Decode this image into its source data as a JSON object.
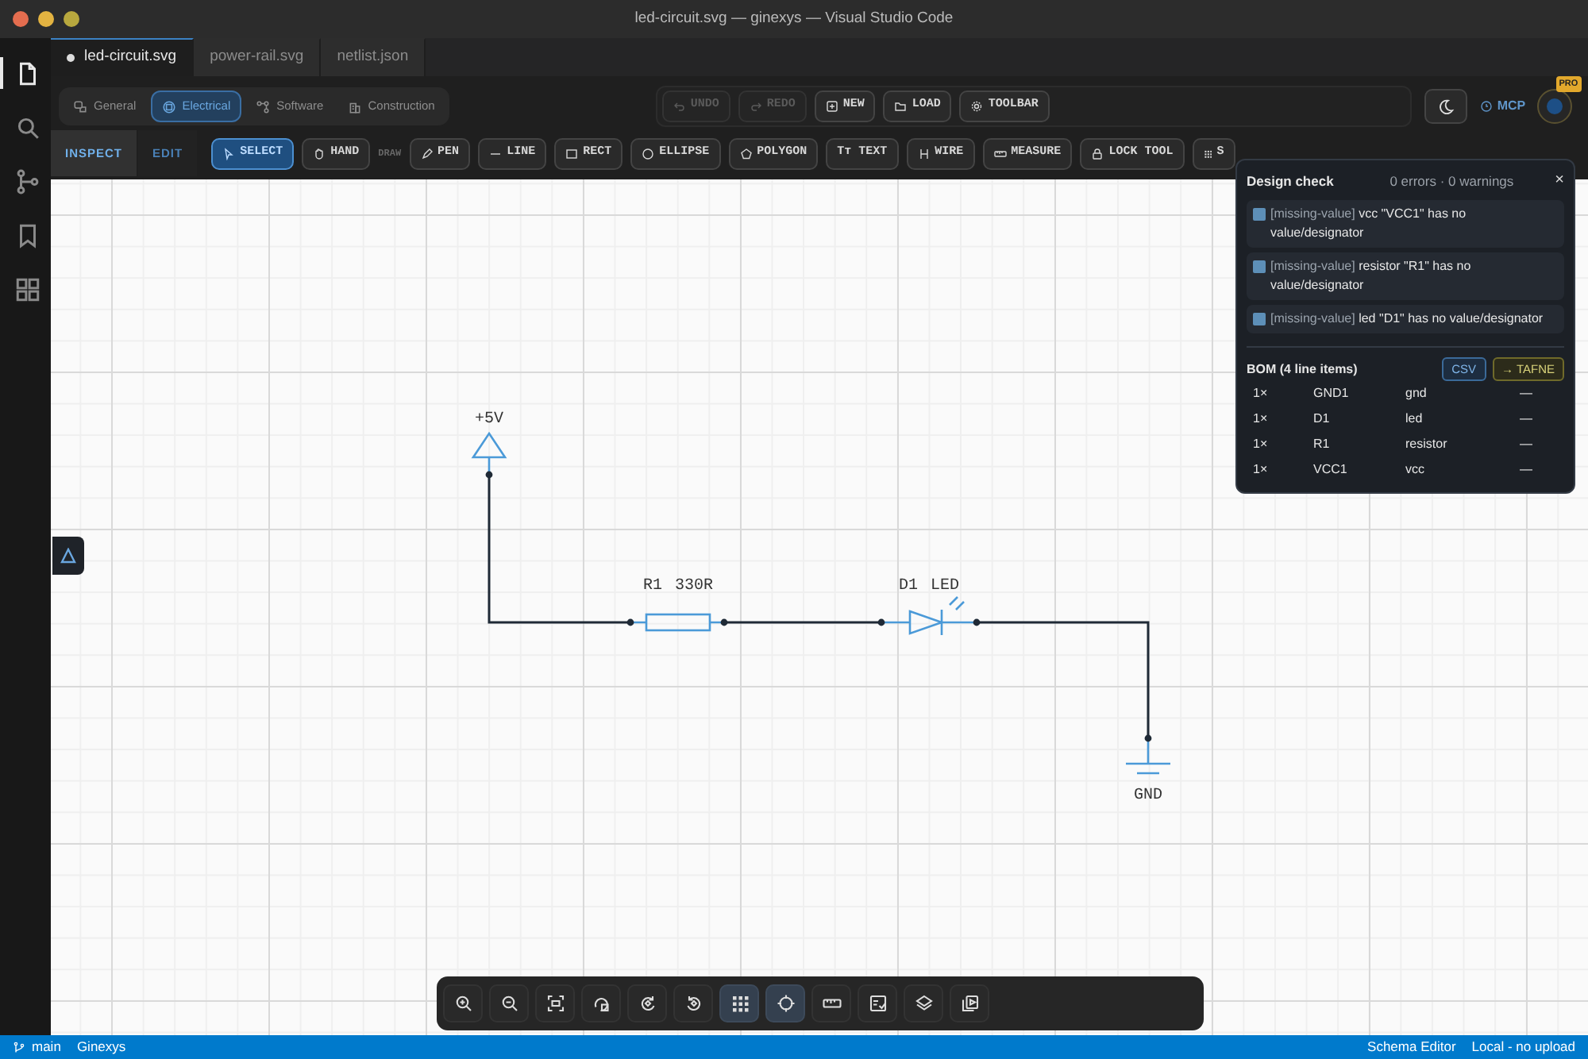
{
  "window": {
    "title": "led-circuit.svg — ginexys — Visual Studio Code"
  },
  "activity_bar": [
    {
      "kind": "files",
      "selected": true
    },
    {
      "kind": "search",
      "selected": false
    },
    {
      "kind": "scm",
      "selected": false
    },
    {
      "kind": "bookmark",
      "selected": false
    },
    {
      "kind": "extensions",
      "selected": false
    }
  ],
  "tabs": [
    {
      "label": "led-circuit.svg",
      "selected": true,
      "modified": true
    },
    {
      "label": "power-rail.svg",
      "selected": false,
      "modified": false
    },
    {
      "label": "netlist.json",
      "selected": false,
      "modified": false
    }
  ],
  "categories": [
    {
      "kind": "general",
      "label": "General",
      "selected": false
    },
    {
      "kind": "electrical",
      "label": "Electrical",
      "selected": true
    },
    {
      "kind": "software",
      "label": "Software",
      "selected": false
    },
    {
      "kind": "construction",
      "label": "Construction",
      "selected": false
    }
  ],
  "actions": [
    {
      "kind": "undo",
      "label": "UNDO",
      "disabled": true
    },
    {
      "kind": "redo",
      "label": "REDO",
      "disabled": true
    },
    {
      "kind": "new",
      "label": "NEW",
      "disabled": false
    },
    {
      "kind": "load",
      "label": "LOAD",
      "disabled": false
    },
    {
      "kind": "toolbar",
      "label": "TOOLBAR",
      "disabled": false
    }
  ],
  "mcp": {
    "label": "MCP"
  },
  "account": {
    "badge": "PRO"
  },
  "modes": [
    {
      "label": "INSPECT",
      "selected": true
    },
    {
      "label": "EDIT",
      "selected": false
    }
  ],
  "tools": [
    {
      "kind": "select",
      "label": "SELECT",
      "selected": true
    },
    {
      "kind": "hand",
      "label": "HAND",
      "selected": false
    },
    {
      "kind": "heading",
      "label": "DRAW"
    },
    {
      "kind": "pen",
      "label": "PEN",
      "selected": false
    },
    {
      "kind": "line",
      "label": "LINE",
      "selected": false
    },
    {
      "kind": "rect",
      "label": "RECT",
      "selected": false
    },
    {
      "kind": "ellipse",
      "label": "ELLIPSE",
      "selected": false
    },
    {
      "kind": "polygon",
      "label": "POLYGON",
      "selected": false
    },
    {
      "kind": "text",
      "glyph": "Tт",
      "label": "TEXT",
      "selected": false
    },
    {
      "kind": "wire",
      "label": "WIRE",
      "selected": false
    },
    {
      "kind": "measure",
      "label": "MEASURE",
      "selected": false
    },
    {
      "kind": "lock",
      "label": "LOCK TOOL",
      "selected": false
    },
    {
      "kind": "grid",
      "label": "S",
      "selected": false
    }
  ],
  "schematic": [
    {
      "kind": "power",
      "label": "+5V"
    },
    {
      "kind": "resistor",
      "designator": "R1",
      "value": "330R"
    },
    {
      "kind": "led",
      "designator": "D1",
      "value": "LED"
    },
    {
      "kind": "ground",
      "label": "GND"
    }
  ],
  "design_check": {
    "title": "Design check",
    "summary": "0 errors · 0 warnings",
    "close": "×",
    "issues": [
      {
        "code": "[missing-value]",
        "message": "vcc \"VCC1\" has no value/designator"
      },
      {
        "code": "[missing-value]",
        "message": "resistor \"R1\" has no value/designator"
      },
      {
        "code": "[missing-value]",
        "message": "led \"D1\" has no value/designator"
      }
    ],
    "bom_title": "BOM (4 line items)",
    "bom_buttons": [
      {
        "kind": "csv",
        "label": "CSV"
      },
      {
        "kind": "export",
        "label": "→ TAFNE"
      }
    ],
    "bom_rows": [
      {
        "qty": "1×",
        "ref": "GND1",
        "type": "gnd",
        "value": "—"
      },
      {
        "qty": "1×",
        "ref": "D1",
        "type": "led",
        "value": "—"
      },
      {
        "qty": "1×",
        "ref": "R1",
        "type": "resistor",
        "value": "—"
      },
      {
        "qty": "1×",
        "ref": "VCC1",
        "type": "vcc",
        "value": "—"
      }
    ]
  },
  "view_toolbar": [
    {
      "kind": "zoomin",
      "selected": false
    },
    {
      "kind": "zoomout",
      "selected": false
    },
    {
      "kind": "fit",
      "selected": false
    },
    {
      "kind": "reset",
      "selected": false
    },
    {
      "kind": "rotcw",
      "selected": false
    },
    {
      "kind": "rotccw",
      "selected": false
    },
    {
      "kind": "grid",
      "selected": true
    },
    {
      "kind": "snap",
      "selected": true
    },
    {
      "kind": "ruler",
      "selected": false
    },
    {
      "kind": "check",
      "selected": false
    },
    {
      "kind": "layers",
      "selected": false
    },
    {
      "kind": "media",
      "selected": false
    }
  ],
  "status_bar": {
    "left": [
      {
        "kind": "branch",
        "label": "main"
      },
      {
        "kind": "plain",
        "label": "Ginexys"
      }
    ],
    "right": [
      {
        "label": "Schema Editor"
      },
      {
        "label": "Local - no upload"
      }
    ]
  }
}
